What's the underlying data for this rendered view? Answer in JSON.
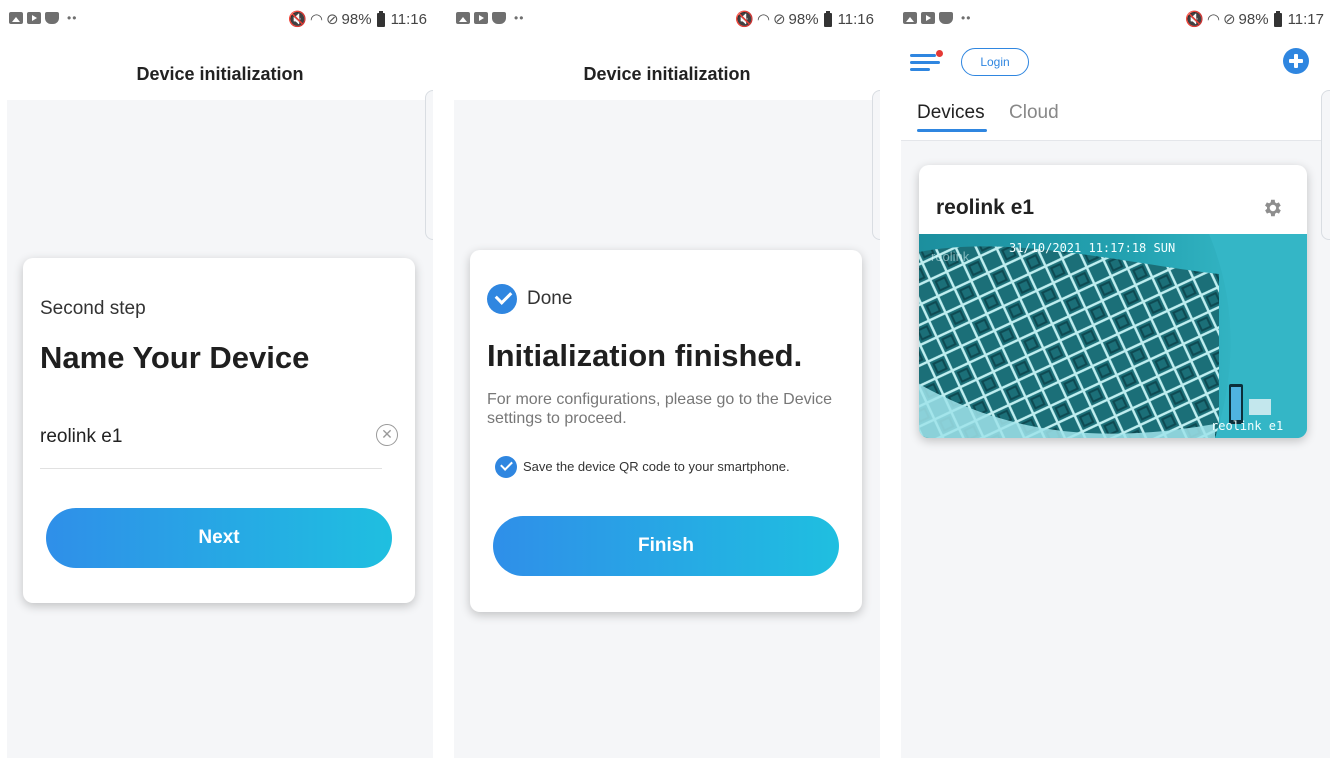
{
  "status_bars": [
    {
      "battery": "98%",
      "time": "11:16"
    },
    {
      "battery": "98%",
      "time": "11:16"
    },
    {
      "battery": "98%",
      "time": "11:17"
    }
  ],
  "screen1": {
    "title": "Device initialization",
    "step_label": "Second step",
    "heading": "Name Your Device",
    "device_name_value": "reolink e1",
    "next_label": "Next"
  },
  "screen2": {
    "title": "Device initialization",
    "done_label": "Done",
    "heading": "Initialization finished.",
    "description": "For more configurations, please go to the Device settings to proceed.",
    "save_qr_label": "Save the device QR code to your smartphone.",
    "save_qr_checked": true,
    "finish_label": "Finish"
  },
  "screen3": {
    "login_label": "Login",
    "tabs": [
      {
        "label": "Devices",
        "active": true
      },
      {
        "label": "Cloud",
        "active": false
      }
    ],
    "device": {
      "name": "reolink e1",
      "overlay_timestamp": "31/10/2021 11:17:18 SUN",
      "watermark": "reolink",
      "camera_label": "reolink e1"
    }
  },
  "colors": {
    "accent": "#2f86e0",
    "button_gradient_start": "#2f8fe9",
    "button_gradient_end": "#1fbfe0",
    "background": "#f5f6f8"
  },
  "icons": [
    "gallery-icon",
    "youtube-icon",
    "shield-icon",
    "mute-icon",
    "wifi-icon",
    "no-disturb-icon",
    "battery-icon",
    "clear-icon",
    "check-icon",
    "menu-icon",
    "add-device-icon",
    "settings-gear-icon"
  ]
}
